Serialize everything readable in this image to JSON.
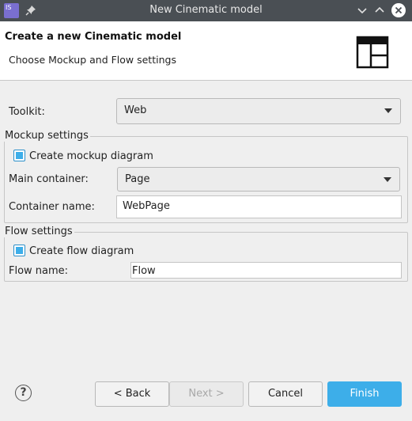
{
  "window": {
    "title": "New Cinematic model",
    "app_icon_text": "IS"
  },
  "header": {
    "title": "Create a new Cinematic model",
    "subtitle": "Choose Mockup and Flow settings"
  },
  "toolkit": {
    "label": "Toolkit:",
    "value": "Web"
  },
  "mockup": {
    "group_title": "Mockup settings",
    "create_diagram_label": "Create mockup diagram",
    "create_diagram_checked": true,
    "main_container_label": "Main container:",
    "main_container_value": "Page",
    "container_name_label": "Container name:",
    "container_name_value": "WebPage"
  },
  "flow": {
    "group_title": "Flow settings",
    "create_diagram_label": "Create flow diagram",
    "create_diagram_checked": true,
    "flow_name_label": "Flow name:",
    "flow_name_value": "Flow"
  },
  "buttons": {
    "help": "?",
    "back": "< Back",
    "next": "Next >",
    "cancel": "Cancel",
    "finish": "Finish"
  },
  "colors": {
    "accent": "#3daee9",
    "titlebar": "#4a4f54"
  }
}
